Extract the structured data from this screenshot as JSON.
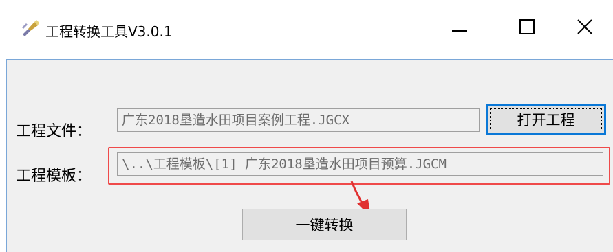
{
  "window": {
    "title": "工程转换工具V3.0.1",
    "controls": {
      "minimize": "minimize",
      "maximize": "maximize",
      "close": "close"
    }
  },
  "form": {
    "project_file_label": "工程文件：",
    "project_file_value": "广东2018垦造水田项目案例工程.JGCX",
    "open_button": "打开工程",
    "template_label": "工程模板：",
    "template_value": "\\..\\工程模板\\[1] 广东2018垦造水田项目预算.JGCM",
    "convert_button": "一键转换"
  },
  "annotation": {
    "highlight_color": "#ef4a4a",
    "arrow_color": "#e03030"
  },
  "icons": [
    "app-icon",
    "minimize-icon",
    "maximize-icon",
    "close-icon"
  ]
}
